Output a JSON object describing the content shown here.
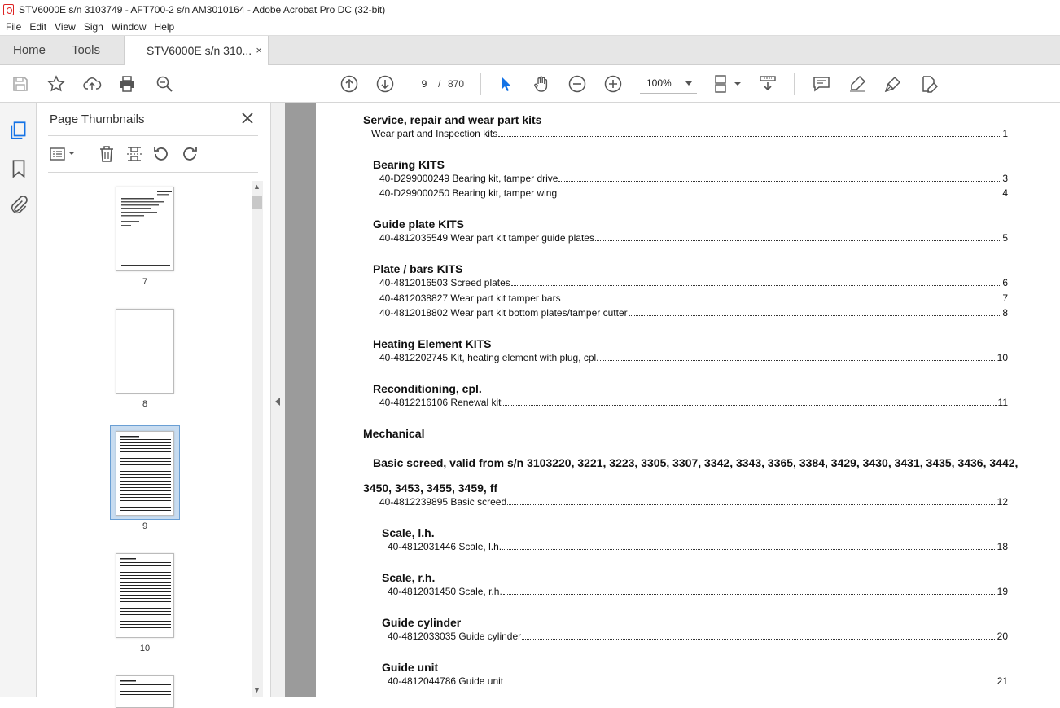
{
  "window": {
    "title": "STV6000E s/n 3103749 - AFT700-2 s/n AM3010164 - Adobe Acrobat Pro DC (32-bit)"
  },
  "menu": [
    "File",
    "Edit",
    "View",
    "Sign",
    "Window",
    "Help"
  ],
  "tabs": {
    "home": "Home",
    "tools": "Tools",
    "document": "STV6000E s/n 310...",
    "close": "×"
  },
  "toolbar": {
    "current_page": "9",
    "separator": "/",
    "total_pages": "870",
    "zoom": "100%"
  },
  "panel": {
    "title": "Page Thumbnails",
    "thumbnails": [
      {
        "label": "7"
      },
      {
        "label": "8"
      },
      {
        "label": "9",
        "selected": true
      },
      {
        "label": "10"
      }
    ]
  },
  "toc": {
    "sections": [
      {
        "heading": "Service, repair and wear part kits",
        "entries": [
          {
            "text": "Wear part and Inspection kits",
            "page": "1"
          }
        ]
      },
      {
        "heading": "Bearing KITS",
        "entries": [
          {
            "text": "40-D299000249 Bearing kit, tamper drive",
            "page": "3"
          },
          {
            "text": "40-D299000250 Bearing kit, tamper wing",
            "page": "4"
          }
        ]
      },
      {
        "heading": "Guide plate KITS",
        "entries": [
          {
            "text": "40-4812035549 Wear part kit tamper guide plates",
            "page": "5"
          }
        ]
      },
      {
        "heading": "Plate / bars KITS",
        "entries": [
          {
            "text": "40-4812016503 Screed plates",
            "page": "6"
          },
          {
            "text": "40-4812038827 Wear part kit tamper bars",
            "page": "7"
          },
          {
            "text": "40-4812018802 Wear part kit bottom plates/tamper cutter",
            "page": "8"
          }
        ]
      },
      {
        "heading": "Heating Element KITS",
        "entries": [
          {
            "text": "40-4812202745 Kit, heating element with plug, cpl.",
            "page": "10"
          }
        ]
      },
      {
        "heading": "Reconditioning, cpl.",
        "entries": [
          {
            "text": "40-4812216106 Renewal kit",
            "page": "11"
          }
        ]
      },
      {
        "heading": "Mechanical",
        "entries": []
      },
      {
        "heading": "Basic screed, valid from s/n 3103220, 3221, 3223, 3305, 3307, 3342, 3343, 3365, 3384, 3429, 3430, 3431, 3435, 3436, 3442,",
        "heading_cont": "3450, 3453, 3455, 3459, ff",
        "entries": [
          {
            "text": "40-4812239895 Basic screed",
            "page": "12"
          }
        ]
      },
      {
        "heading": "Scale, l.h.",
        "entries": [
          {
            "text": "40-4812031446 Scale, l.h.",
            "page": "18"
          }
        ]
      },
      {
        "heading": "Scale, r.h.",
        "entries": [
          {
            "text": "40-4812031450 Scale, r.h.",
            "page": "19"
          }
        ]
      },
      {
        "heading": "Guide cylinder",
        "entries": [
          {
            "text": "40-4812033035 Guide cylinder",
            "page": "20"
          }
        ]
      },
      {
        "heading": "Guide unit",
        "entries": [
          {
            "text": "40-4812044786 Guide unit",
            "page": "21"
          }
        ]
      }
    ]
  }
}
